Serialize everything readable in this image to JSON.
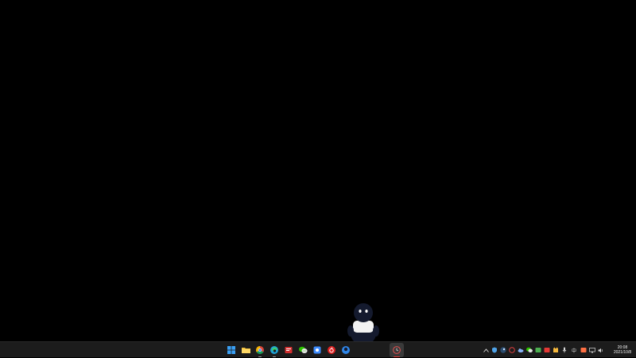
{
  "taskbar": {
    "apps": [
      {
        "name": "start",
        "icon": "windows-logo-icon"
      },
      {
        "name": "file-explorer",
        "icon": "folder-icon"
      },
      {
        "name": "chrome",
        "icon": "chrome-icon"
      },
      {
        "name": "edge",
        "icon": "edge-icon"
      },
      {
        "name": "red-app",
        "icon": "red-app-icon"
      },
      {
        "name": "wechat",
        "icon": "wechat-icon"
      },
      {
        "name": "blue-app",
        "icon": "blue-app-icon"
      },
      {
        "name": "netease-music",
        "icon": "netease-music-icon"
      },
      {
        "name": "mascot-app",
        "icon": "mascot-icon"
      },
      {
        "name": "clock-app",
        "icon": "clock-app-icon"
      }
    ],
    "tray": {
      "ime_label": "中",
      "time": "20:08",
      "date": "2021/10/8"
    }
  },
  "colors": {
    "desktop": "#000000",
    "taskbar": "#1c1c1c",
    "active_indicator": "#e53935"
  }
}
